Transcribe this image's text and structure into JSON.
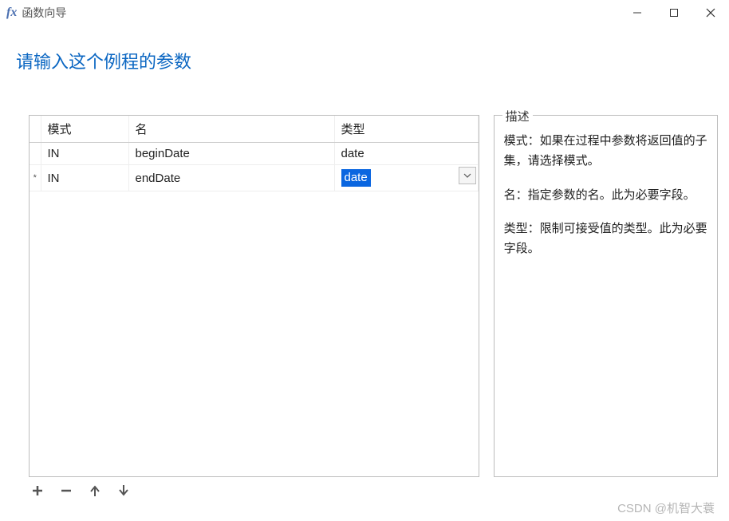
{
  "window": {
    "icon_text": "fx",
    "title": "函数向导"
  },
  "heading": "请输入这个例程的参数",
  "table": {
    "headers": {
      "mode": "模式",
      "name": "名",
      "type": "类型"
    },
    "rows": [
      {
        "marker": "",
        "mode": "IN",
        "name": "beginDate",
        "type": "date",
        "active": false
      },
      {
        "marker": "*",
        "mode": "IN",
        "name": "endDate",
        "type": "date",
        "active": true
      }
    ]
  },
  "description": {
    "label": "描述",
    "p1": "模式：如果在过程中参数将返回值的子集，请选择模式。",
    "p2": "名：指定参数的名。此为必要字段。",
    "p3": "类型：限制可接受值的类型。此为必要字段。"
  },
  "toolbar": {
    "add": "add",
    "remove": "remove",
    "up": "up",
    "down": "down"
  },
  "watermark": "CSDN @机智大蓑"
}
